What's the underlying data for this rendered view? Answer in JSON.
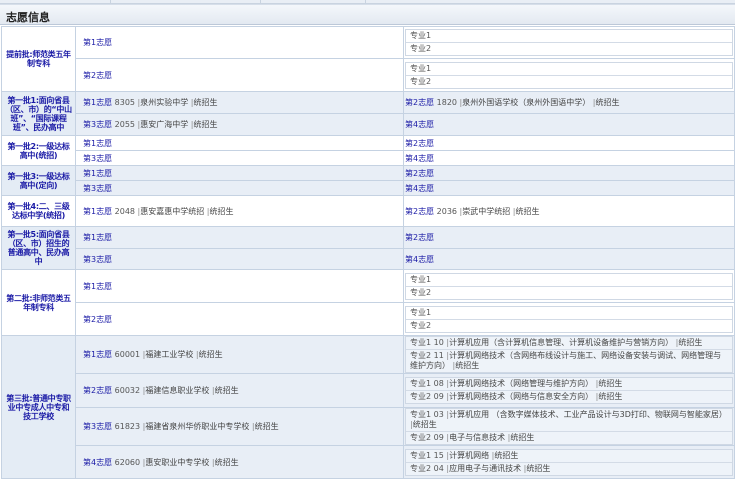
{
  "section_title": "志愿信息",
  "rows": [
    {
      "category": "提前批:师范类五年制专科",
      "entries": [
        {
          "left": {
            "label": "第1志愿",
            "code": "",
            "school": "",
            "plan": ""
          },
          "right_type": "majors",
          "majors": [
            {
              "label": "专业1",
              "code": "",
              "name": "",
              "plan": ""
            },
            {
              "label": "专业2",
              "code": "",
              "name": "",
              "plan": ""
            }
          ]
        },
        {
          "left": {
            "label": "第2志愿",
            "code": "",
            "school": "",
            "plan": ""
          },
          "right_type": "majors",
          "majors": [
            {
              "label": "专业1",
              "code": "",
              "name": "",
              "plan": ""
            },
            {
              "label": "专业2",
              "code": "",
              "name": "",
              "plan": ""
            }
          ]
        }
      ]
    },
    {
      "category": "第一批1:面向省县（区、市）的“中山班”、“国际课程班”、民办高中",
      "entries": [
        {
          "left": {
            "label": "第1志愿",
            "code": "8305",
            "school": "泉州实验中学",
            "plan": "统招生"
          },
          "right": {
            "label": "第2志愿",
            "code": "1820",
            "school": "泉州外国语学校（泉州外国语中学）",
            "plan": "统招生"
          }
        },
        {
          "left": {
            "label": "第3志愿",
            "code": "2055",
            "school": "惠安广海中学",
            "plan": "统招生"
          },
          "right": {
            "label": "第4志愿",
            "code": "",
            "school": "",
            "plan": ""
          }
        }
      ]
    },
    {
      "category": "第一批2:一级达标高中(统招)",
      "entries": [
        {
          "left": {
            "label": "第1志愿",
            "code": "",
            "school": "",
            "plan": ""
          },
          "right": {
            "label": "第2志愿",
            "code": "",
            "school": "",
            "plan": ""
          }
        },
        {
          "left": {
            "label": "第3志愿",
            "code": "",
            "school": "",
            "plan": ""
          },
          "right": {
            "label": "第4志愿",
            "code": "",
            "school": "",
            "plan": ""
          }
        }
      ]
    },
    {
      "category": "第一批3:一级达标高中(定向)",
      "entries": [
        {
          "left": {
            "label": "第1志愿",
            "code": "",
            "school": "",
            "plan": ""
          },
          "right": {
            "label": "第2志愿",
            "code": "",
            "school": "",
            "plan": ""
          }
        },
        {
          "left": {
            "label": "第3志愿",
            "code": "",
            "school": "",
            "plan": ""
          },
          "right": {
            "label": "第4志愿",
            "code": "",
            "school": "",
            "plan": ""
          }
        }
      ]
    },
    {
      "category": "第一批4:二、三级达标中学(统招)",
      "entries": [
        {
          "left": {
            "label": "第1志愿",
            "code": "2048",
            "school": "惠安嘉惠中学统招",
            "plan": "统招生"
          },
          "right": {
            "label": "第2志愿",
            "code": "2036",
            "school": "崇武中学统招",
            "plan": "统招生"
          }
        }
      ]
    },
    {
      "category": "第一批5:面向省县（区、市）招生的普通高中、民办高中",
      "entries": [
        {
          "left": {
            "label": "第1志愿",
            "code": "",
            "school": "",
            "plan": ""
          },
          "right": {
            "label": "第2志愿",
            "code": "",
            "school": "",
            "plan": ""
          }
        },
        {
          "left": {
            "label": "第3志愿",
            "code": "",
            "school": "",
            "plan": ""
          },
          "right": {
            "label": "第4志愿",
            "code": "",
            "school": "",
            "plan": ""
          }
        }
      ]
    },
    {
      "category": "第二批:非师范类五年制专科",
      "entries": [
        {
          "left": {
            "label": "第1志愿",
            "code": "",
            "school": "",
            "plan": ""
          },
          "right_type": "majors",
          "majors": [
            {
              "label": "专业1",
              "code": "",
              "name": "",
              "plan": ""
            },
            {
              "label": "专业2",
              "code": "",
              "name": "",
              "plan": ""
            }
          ]
        },
        {
          "left": {
            "label": "第2志愿",
            "code": "",
            "school": "",
            "plan": ""
          },
          "right_type": "majors",
          "majors": [
            {
              "label": "专业1",
              "code": "",
              "name": "",
              "plan": ""
            },
            {
              "label": "专业2",
              "code": "",
              "name": "",
              "plan": ""
            }
          ]
        }
      ]
    },
    {
      "category": "第三批:普通中专职业中专成人中专和技工学校",
      "entries": [
        {
          "left": {
            "label": "第1志愿",
            "code": "60001",
            "school": "福建工业学校",
            "plan": "统招生"
          },
          "right_type": "majors",
          "majors": [
            {
              "label": "专业1",
              "code": "10",
              "name": "计算机应用（含计算机信息管理、计算机设备维护与营销方向）",
              "plan": "统招生"
            },
            {
              "label": "专业2",
              "code": "11",
              "name": "计算机网络技术（含网络布线设计与施工、网络设备安装与调试、网络管理与维护方向）",
              "plan": "统招生"
            }
          ]
        },
        {
          "left": {
            "label": "第2志愿",
            "code": "60032",
            "school": "福建信息职业学校",
            "plan": "统招生"
          },
          "right_type": "majors",
          "majors": [
            {
              "label": "专业1",
              "code": "08",
              "name": "计算机网络技术（网络管理与维护方向）",
              "plan": "统招生"
            },
            {
              "label": "专业2",
              "code": "09",
              "name": "计算机网络技术（网络与信息安全方向）",
              "plan": "统招生"
            }
          ]
        },
        {
          "left": {
            "label": "第3志愿",
            "code": "61823",
            "school": "福建省泉州华侨职业中专学校",
            "plan": "统招生"
          },
          "right_type": "majors",
          "majors": [
            {
              "label": "专业1",
              "code": "03",
              "name": "计算机应用 （含数字媒体技术、工业产品设计与3D打印、物联网与智能家居）",
              "plan": "统招生"
            },
            {
              "label": "专业2",
              "code": "09",
              "name": "电子与信息技术",
              "plan": "统招生"
            }
          ]
        },
        {
          "left": {
            "label": "第4志愿",
            "code": "62060",
            "school": "惠安职业中专学校",
            "plan": "统招生"
          },
          "right_type": "majors",
          "majors": [
            {
              "label": "专业1",
              "code": "15",
              "name": "计算机网络",
              "plan": "统招生"
            },
            {
              "label": "专业2",
              "code": "04",
              "name": "应用电子与通讯技术",
              "plan": "统招生"
            }
          ]
        }
      ]
    }
  ]
}
